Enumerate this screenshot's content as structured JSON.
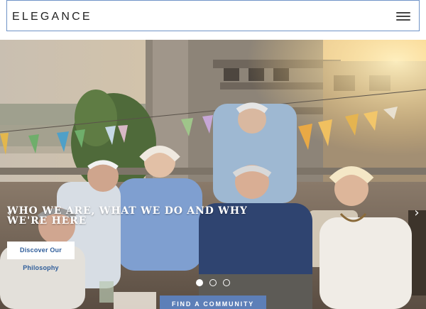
{
  "header": {
    "brand": "ELEGANCE",
    "menu_icon": "hamburger-menu-icon"
  },
  "hero": {
    "title": "WHO WE ARE, WHAT WE DO AND WHY WE'RE HERE",
    "cta_label": "Discover Our Philosophy",
    "prev_icon": "chevron-left-icon",
    "next_icon": "chevron-right-icon",
    "prev_glyph": "‹",
    "next_glyph": "›",
    "slides": 3,
    "active_slide": 1
  },
  "footer_cta": {
    "label": "FIND A COMMUNITY"
  },
  "colors": {
    "accent": "#5d7fb8",
    "header_border": "#6f93c7",
    "cta_text": "#2f5d9a"
  }
}
